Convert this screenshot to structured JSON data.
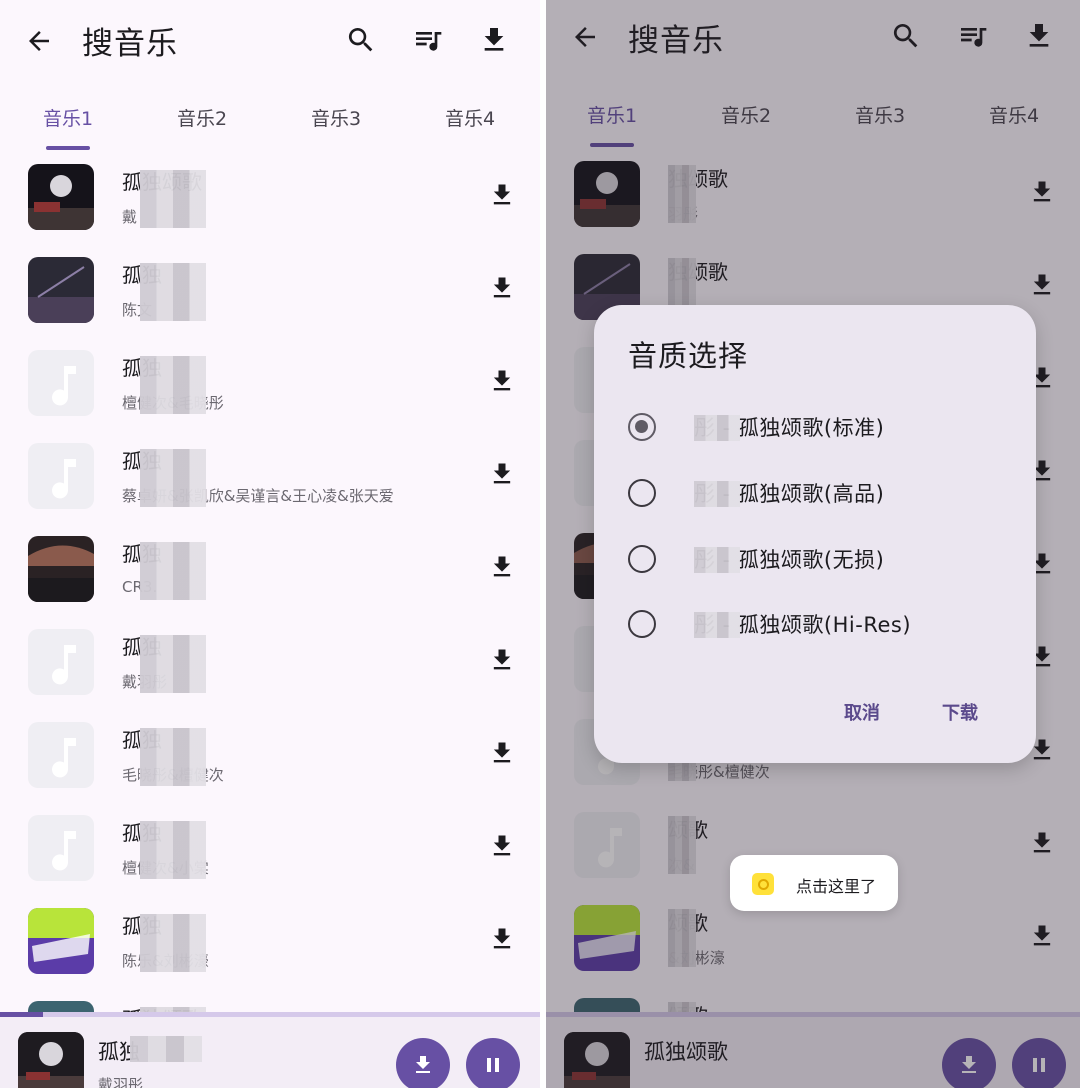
{
  "colors": {
    "accent": "#6750a4",
    "background": "#fcf7fd",
    "placeholder": "#efeef3"
  },
  "left": {
    "appbar": {
      "title": "搜音乐",
      "icons": [
        "arrow-back-icon",
        "search-icon",
        "playlist-icon",
        "download-icon"
      ]
    },
    "tabs": [
      "音乐1",
      "音乐2",
      "音乐3",
      "音乐4"
    ],
    "active_tab": 0,
    "songs": [
      {
        "title": "孤独颂歌",
        "artist": "戴"
      },
      {
        "title": "孤独",
        "artist": "陈文"
      },
      {
        "title": "孤独",
        "artist": "檀健次&毛晓彤"
      },
      {
        "title": "孤独",
        "artist": "蔡卓妍&张凯欣&吴谨言&王心凌&张天爱"
      },
      {
        "title": "孤独",
        "artist": "CR3."
      },
      {
        "title": "孤独",
        "artist": "戴羽彤"
      },
      {
        "title": "孤独",
        "artist": "毛晓彤&檀健次"
      },
      {
        "title": "孤独",
        "artist": "檀健次&小棠"
      },
      {
        "title": "孤独",
        "artist": "陈乐&刘彬濠"
      },
      {
        "title": "孤独颂歌",
        "artist": ""
      }
    ],
    "player": {
      "title": "孤独",
      "artist": "戴羽彤",
      "progress": 0.08
    }
  },
  "right": {
    "appbar": {
      "title": "搜音乐"
    },
    "tabs": [
      "音乐1",
      "音乐2",
      "音乐3",
      "音乐4"
    ],
    "active_tab": 0,
    "songs": [
      {
        "title": "独颂歌",
        "artist": "羽彤"
      },
      {
        "title": "独颂歌",
        "artist": ""
      },
      {
        "title": "",
        "artist": ""
      },
      {
        "title": "",
        "artist": ""
      },
      {
        "title": "",
        "artist": ""
      },
      {
        "title": "",
        "artist": ""
      },
      {
        "title": "",
        "artist": "毛晓彤&檀健次"
      },
      {
        "title": "颂歌",
        "artist": "次&"
      },
      {
        "title": "颂歌",
        "artist": "&刘彬濠"
      },
      {
        "title": "颂歌",
        "artist": ""
      }
    ],
    "player": {
      "title": "孤独颂歌"
    },
    "dialog": {
      "title": "音质选择",
      "options": [
        "彤 - 孤独颂歌(标准)",
        "彤 - 孤独颂歌(高品)",
        "彤 - 孤独颂歌(无损)",
        "彤 - 孤独颂歌(Hi-Res)"
      ],
      "selected": 0,
      "cancel": "取消",
      "confirm": "下载"
    },
    "toast": "点击这里了"
  }
}
